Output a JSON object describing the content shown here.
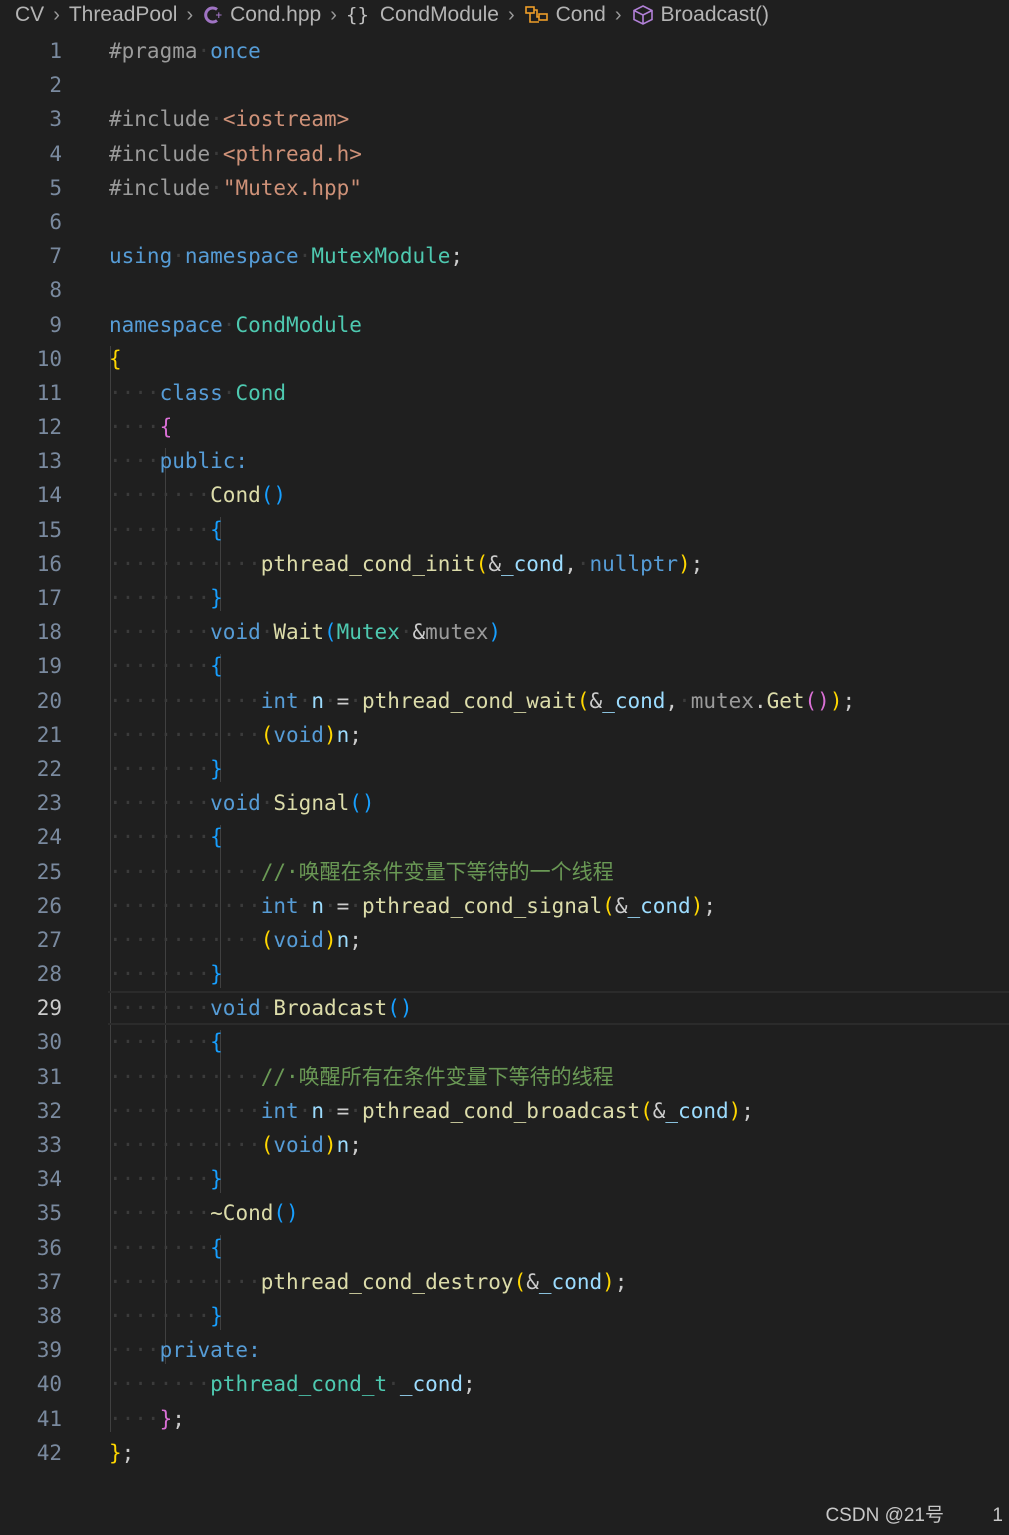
{
  "breadcrumb": {
    "items": [
      {
        "label": "CV",
        "icon": ""
      },
      {
        "label": "ThreadPool",
        "icon": ""
      },
      {
        "label": "Cond.hpp",
        "icon": "cpp-file-icon"
      },
      {
        "label": "CondModule",
        "icon": "namespace-braces-icon"
      },
      {
        "label": "Cond",
        "icon": "class-icon"
      },
      {
        "label": "Broadcast()",
        "icon": "method-cube-icon"
      }
    ]
  },
  "editor": {
    "current_line": 29,
    "lines": [
      [
        [
          "pp",
          "#pragma"
        ],
        [
          "ws",
          "·"
        ],
        [
          "kw",
          "once"
        ]
      ],
      [],
      [
        [
          "pp",
          "#include"
        ],
        [
          "ws",
          "·"
        ],
        [
          "str",
          "<iostream>"
        ]
      ],
      [
        [
          "pp",
          "#include"
        ],
        [
          "ws",
          "·"
        ],
        [
          "str",
          "<pthread.h>"
        ]
      ],
      [
        [
          "pp",
          "#include"
        ],
        [
          "ws",
          "·"
        ],
        [
          "str",
          "\"Mutex.hpp\""
        ]
      ],
      [],
      [
        [
          "kw",
          "using"
        ],
        [
          "ws",
          "·"
        ],
        [
          "kw",
          "namespace"
        ],
        [
          "ws",
          "·"
        ],
        [
          "typ",
          "MutexModule"
        ],
        [
          "t",
          ";"
        ]
      ],
      [],
      [
        [
          "kw",
          "namespace"
        ],
        [
          "ws",
          "·"
        ],
        [
          "typ",
          "CondModule"
        ]
      ],
      [
        [
          "b1",
          "{"
        ]
      ],
      [
        [
          "ws",
          "····"
        ],
        [
          "kw",
          "class"
        ],
        [
          "ws",
          "·"
        ],
        [
          "typ",
          "Cond"
        ]
      ],
      [
        [
          "ws",
          "····"
        ],
        [
          "b2",
          "{"
        ]
      ],
      [
        [
          "ws",
          "····"
        ],
        [
          "kw",
          "public:"
        ]
      ],
      [
        [
          "ws",
          "········"
        ],
        [
          "fn",
          "Cond"
        ],
        [
          "b3",
          "()"
        ]
      ],
      [
        [
          "ws",
          "········"
        ],
        [
          "b3",
          "{"
        ]
      ],
      [
        [
          "ws",
          "············"
        ],
        [
          "fn",
          "pthread_cond_init"
        ],
        [
          "b1",
          "("
        ],
        [
          "t",
          "&"
        ],
        [
          "param",
          "_cond"
        ],
        [
          "t",
          ","
        ],
        [
          "ws",
          "·"
        ],
        [
          "kw",
          "nullptr"
        ],
        [
          "b1",
          ")"
        ],
        [
          "t",
          ";"
        ]
      ],
      [
        [
          "ws",
          "········"
        ],
        [
          "b3",
          "}"
        ]
      ],
      [
        [
          "ws",
          "········"
        ],
        [
          "kw",
          "void"
        ],
        [
          "ws",
          "·"
        ],
        [
          "fn",
          "Wait"
        ],
        [
          "b3",
          "("
        ],
        [
          "typ",
          "Mutex"
        ],
        [
          "ws",
          "·"
        ],
        [
          "t",
          "&"
        ],
        [
          "pp",
          "mutex"
        ],
        [
          "b3",
          ")"
        ]
      ],
      [
        [
          "ws",
          "········"
        ],
        [
          "b3",
          "{"
        ]
      ],
      [
        [
          "ws",
          "············"
        ],
        [
          "kw",
          "int"
        ],
        [
          "ws",
          "·"
        ],
        [
          "param",
          "n"
        ],
        [
          "ws",
          "·"
        ],
        [
          "t",
          "="
        ],
        [
          "ws",
          "·"
        ],
        [
          "fn",
          "pthread_cond_wait"
        ],
        [
          "b1",
          "("
        ],
        [
          "t",
          "&"
        ],
        [
          "param",
          "_cond"
        ],
        [
          "t",
          ","
        ],
        [
          "ws",
          "·"
        ],
        [
          "pp",
          "mutex"
        ],
        [
          "t",
          "."
        ],
        [
          "fn",
          "Get"
        ],
        [
          "b2",
          "()"
        ],
        [
          "b1",
          ")"
        ],
        [
          "t",
          ";"
        ]
      ],
      [
        [
          "ws",
          "············"
        ],
        [
          "b1",
          "("
        ],
        [
          "kw",
          "void"
        ],
        [
          "b1",
          ")"
        ],
        [
          "param",
          "n"
        ],
        [
          "t",
          ";"
        ]
      ],
      [
        [
          "ws",
          "········"
        ],
        [
          "b3",
          "}"
        ]
      ],
      [
        [
          "ws",
          "········"
        ],
        [
          "kw",
          "void"
        ],
        [
          "ws",
          "·"
        ],
        [
          "fn",
          "Signal"
        ],
        [
          "b3",
          "()"
        ]
      ],
      [
        [
          "ws",
          "········"
        ],
        [
          "b3",
          "{"
        ]
      ],
      [
        [
          "ws",
          "············"
        ],
        [
          "cm",
          "//·唤醒在条件变量下等待的一个线程"
        ]
      ],
      [
        [
          "ws",
          "············"
        ],
        [
          "kw",
          "int"
        ],
        [
          "ws",
          "·"
        ],
        [
          "param",
          "n"
        ],
        [
          "ws",
          "·"
        ],
        [
          "t",
          "="
        ],
        [
          "ws",
          "·"
        ],
        [
          "fn",
          "pthread_cond_signal"
        ],
        [
          "b1",
          "("
        ],
        [
          "t",
          "&"
        ],
        [
          "param",
          "_cond"
        ],
        [
          "b1",
          ")"
        ],
        [
          "t",
          ";"
        ]
      ],
      [
        [
          "ws",
          "············"
        ],
        [
          "b1",
          "("
        ],
        [
          "kw",
          "void"
        ],
        [
          "b1",
          ")"
        ],
        [
          "param",
          "n"
        ],
        [
          "t",
          ";"
        ]
      ],
      [
        [
          "ws",
          "········"
        ],
        [
          "b3",
          "}"
        ]
      ],
      [
        [
          "ws",
          "········"
        ],
        [
          "kw",
          "void"
        ],
        [
          "ws",
          "·"
        ],
        [
          "fn",
          "Broadcast"
        ],
        [
          "b3",
          "()"
        ]
      ],
      [
        [
          "ws",
          "········"
        ],
        [
          "b3",
          "{"
        ]
      ],
      [
        [
          "ws",
          "············"
        ],
        [
          "cm",
          "//·唤醒所有在条件变量下等待的线程"
        ]
      ],
      [
        [
          "ws",
          "············"
        ],
        [
          "kw",
          "int"
        ],
        [
          "ws",
          "·"
        ],
        [
          "param",
          "n"
        ],
        [
          "ws",
          "·"
        ],
        [
          "t",
          "="
        ],
        [
          "ws",
          "·"
        ],
        [
          "fn",
          "pthread_cond_broadcast"
        ],
        [
          "b1",
          "("
        ],
        [
          "t",
          "&"
        ],
        [
          "param",
          "_cond"
        ],
        [
          "b1",
          ")"
        ],
        [
          "t",
          ";"
        ]
      ],
      [
        [
          "ws",
          "············"
        ],
        [
          "b1",
          "("
        ],
        [
          "kw",
          "void"
        ],
        [
          "b1",
          ")"
        ],
        [
          "param",
          "n"
        ],
        [
          "t",
          ";"
        ]
      ],
      [
        [
          "ws",
          "········"
        ],
        [
          "b3",
          "}"
        ]
      ],
      [
        [
          "ws",
          "········"
        ],
        [
          "fn",
          "~Cond"
        ],
        [
          "b3",
          "()"
        ]
      ],
      [
        [
          "ws",
          "········"
        ],
        [
          "b3",
          "{"
        ]
      ],
      [
        [
          "ws",
          "············"
        ],
        [
          "fn",
          "pthread_cond_destroy"
        ],
        [
          "b1",
          "("
        ],
        [
          "t",
          "&"
        ],
        [
          "param",
          "_cond"
        ],
        [
          "b1",
          ")"
        ],
        [
          "t",
          ";"
        ]
      ],
      [
        [
          "ws",
          "········"
        ],
        [
          "b3",
          "}"
        ]
      ],
      [
        [
          "ws",
          "····"
        ],
        [
          "kw",
          "private:"
        ]
      ],
      [
        [
          "ws",
          "········"
        ],
        [
          "typ",
          "pthread_cond_t"
        ],
        [
          "ws",
          "·"
        ],
        [
          "param",
          "_cond"
        ],
        [
          "t",
          ";"
        ]
      ],
      [
        [
          "ws",
          "····"
        ],
        [
          "b2",
          "}"
        ],
        [
          "t",
          ";"
        ]
      ],
      [
        [
          "b1",
          "}"
        ],
        [
          "t",
          ";"
        ]
      ]
    ]
  },
  "watermark": "CSDN @21号",
  "corner_text": "1"
}
